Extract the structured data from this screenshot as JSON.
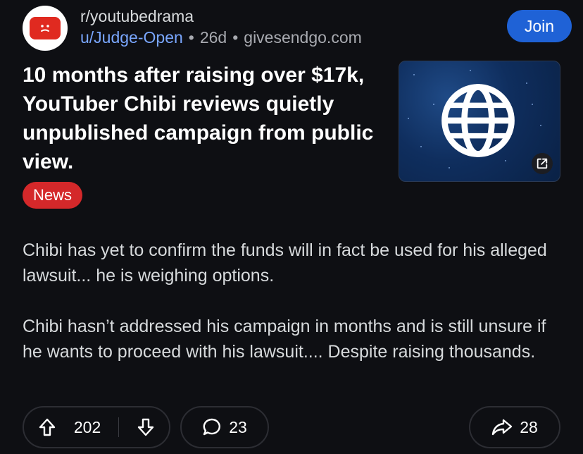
{
  "header": {
    "subreddit": "r/youtubedrama",
    "username": "u/Judge-Open",
    "age": "26d",
    "domain": "givesendgo.com",
    "separator": "•",
    "join_label": "Join"
  },
  "post": {
    "title": "10 months after raising over $17k, YouTuber Chibi reviews quietly unpublished campaign from public view.",
    "flair": "News",
    "flair_color": "#d4282a",
    "body": [
      "Chibi has yet to confirm the funds will in fact be used for his alleged lawsuit... he is weighing options.",
      "Chibi hasn’t addressed his campaign in months and is still unsure if he wants to proceed with his lawsuit.... Despite raising thousands."
    ],
    "thumbnail_icon": "globe-icon"
  },
  "actions": {
    "upvotes": "202",
    "comments": "23",
    "shares": "28"
  },
  "colors": {
    "background": "#0e0f13",
    "join_button": "#1f62d6",
    "user_link": "#7aa7ff"
  }
}
